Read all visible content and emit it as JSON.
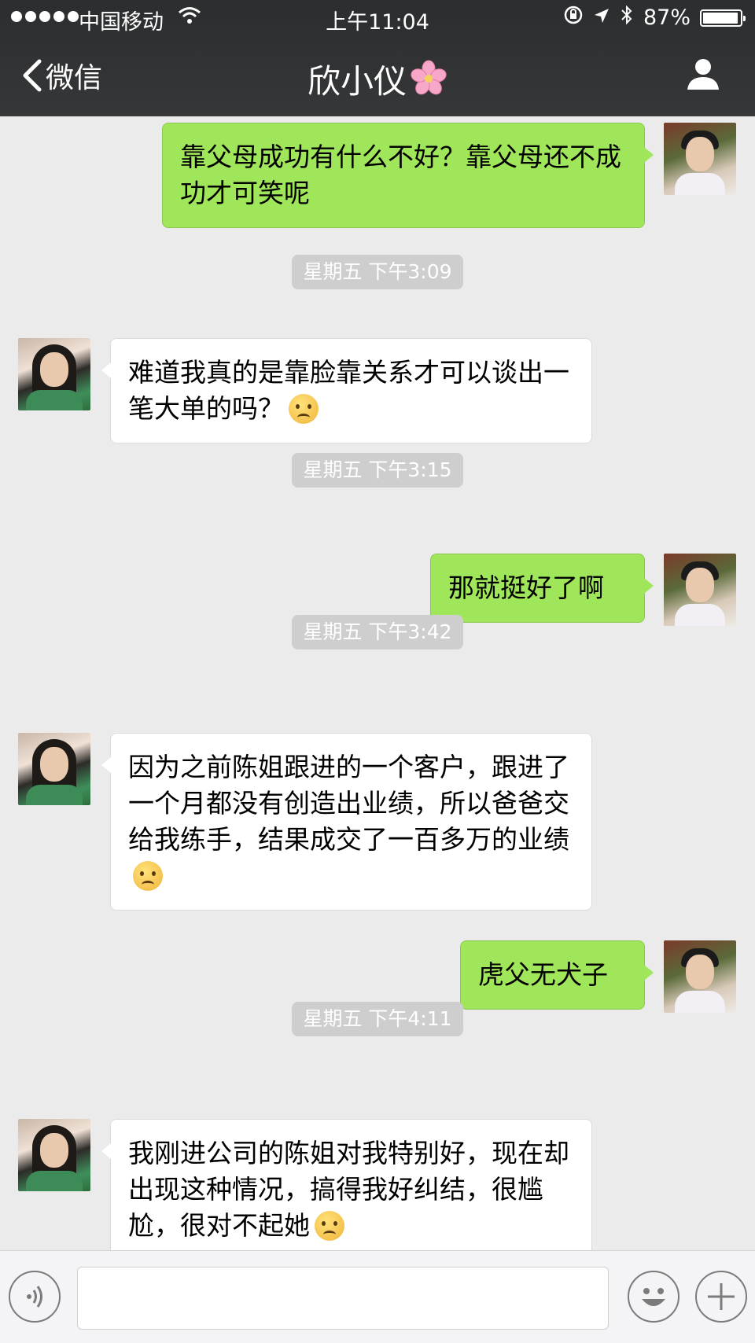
{
  "status_bar": {
    "carrier": "中国移动",
    "time": "上午11:04",
    "battery": "87%",
    "battery_level": 0.87
  },
  "nav": {
    "back_label": "微信",
    "title": "欣小仪",
    "title_emoji": "cherry-blossom-icon",
    "profile_icon": "person-icon"
  },
  "messages": [
    {
      "type": "out",
      "text": "靠父母成功有什么不好？靠父母还不成功才可笑呢"
    },
    {
      "type": "time",
      "text": "星期五 下午3:09"
    },
    {
      "type": "in",
      "text": "难道我真的是靠脸靠关系才可以谈出一笔大单的吗？",
      "emoji": "sad-face-emoji"
    },
    {
      "type": "time",
      "text": "星期五 下午3:15"
    },
    {
      "type": "out",
      "text": "那就挺好了啊"
    },
    {
      "type": "time",
      "text": "星期五 下午3:42"
    },
    {
      "type": "in",
      "text": "因为之前陈姐跟进的一个客户，跟进了一个月都没有创造出业绩，所以爸爸交给我练手，结果成交了一百多万的业绩",
      "emoji": "frown-face-emoji"
    },
    {
      "type": "out",
      "text": "虎父无犬子"
    },
    {
      "type": "time",
      "text": "星期五 下午4:11"
    },
    {
      "type": "in",
      "text": "我刚进公司的陈姐对我特别好，现在却出现这种情况，搞得我好纠结，很尴尬，很对不起她",
      "emoji": "sad-face-emoji"
    }
  ],
  "input_bar": {
    "voice_icon": "voice-icon",
    "emoji_icon": "emoji-icon",
    "plus_icon": "plus-icon",
    "text_value": ""
  }
}
